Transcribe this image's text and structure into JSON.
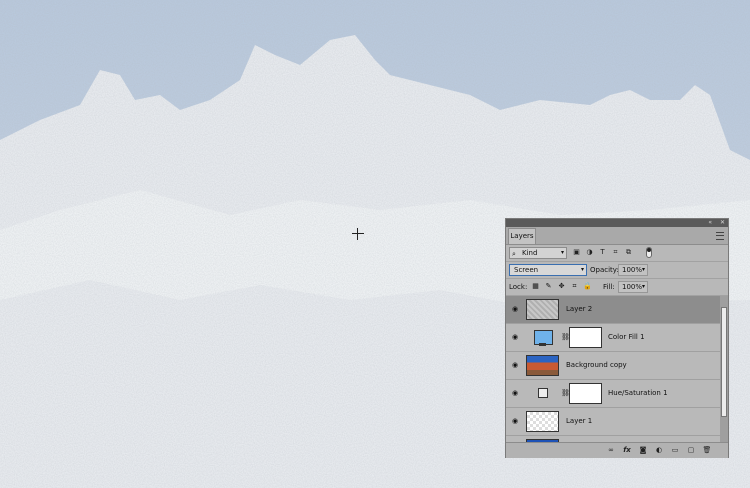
{
  "panel": {
    "tab_label": "Layers",
    "kind_label": "Kind",
    "blend_mode": "Screen",
    "opacity_label": "Opacity:",
    "opacity_value": "100%",
    "lock_label": "Lock:",
    "fill_label": "Fill:",
    "fill_value": "100%"
  },
  "layers": [
    {
      "name": "Layer 2"
    },
    {
      "name": "Color Fill 1"
    },
    {
      "name": "Background copy"
    },
    {
      "name": "Hue/Saturation 1"
    },
    {
      "name": "Layer 1"
    }
  ],
  "bottom_icons": [
    "link-icon",
    "fx-icon",
    "add-mask-icon",
    "adjustment-icon",
    "folder-icon",
    "new-layer-icon",
    "trash-icon"
  ]
}
